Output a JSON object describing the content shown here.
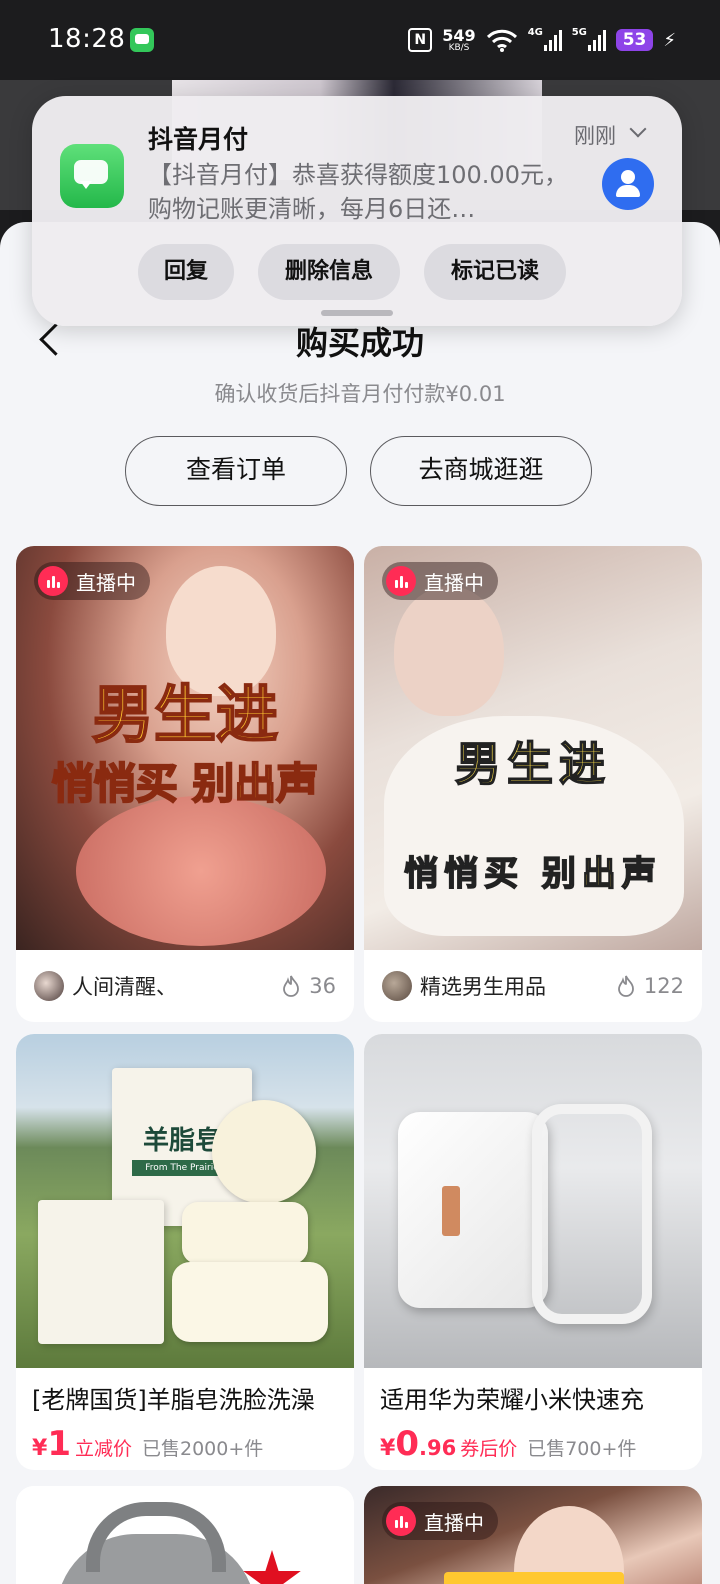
{
  "status_bar": {
    "time": "18:28",
    "net_speed": "549",
    "net_unit": "KB/S",
    "sig1": "4G",
    "sig2": "5G",
    "battery": "53"
  },
  "notification": {
    "app": "抖音月付",
    "time": "刚刚",
    "body": "【抖音月付】恭喜获得额度100.00元，购物记账更清晰，每月6日还…",
    "actions": [
      "回复",
      "删除信息",
      "标记已读"
    ]
  },
  "page": {
    "title": "购买成功",
    "subtitle": "确认收货后抖音月付付款¥0.01",
    "view_order": "查看订单",
    "go_mall": "去商城逛逛"
  },
  "feed": [
    {
      "badge": "直播中",
      "overlay_line1": "男生进",
      "overlay_line2": "悄悄买 别出声",
      "author": "人间清醒、",
      "heat": "36"
    },
    {
      "badge": "直播中",
      "overlay_line1": "男生进",
      "overlay_line2": "悄悄买 别出声",
      "author": "精选男生用品",
      "heat": "122"
    },
    {
      "title": "[老牌国货]羊脂皂洗脸洗澡",
      "currency": "¥",
      "price_int": "1",
      "price_dec": "",
      "price_tag": "立减价",
      "sold": "已售2000+件",
      "img_text1": "羊脂皂",
      "img_text2": "From The Prairie"
    },
    {
      "title": "适用华为荣耀小米快速充",
      "currency": "¥",
      "price_int": "0",
      "price_dec": ".96",
      "price_tag": "券后价",
      "sold": "已售700+件"
    },
    {
      "badge": "直播中"
    }
  ],
  "colors": {
    "accent": "#ff2c55",
    "sheet_bg": "#f4f5f8",
    "notif_contact": "#2f6df0",
    "battery": "#8e44e8"
  }
}
